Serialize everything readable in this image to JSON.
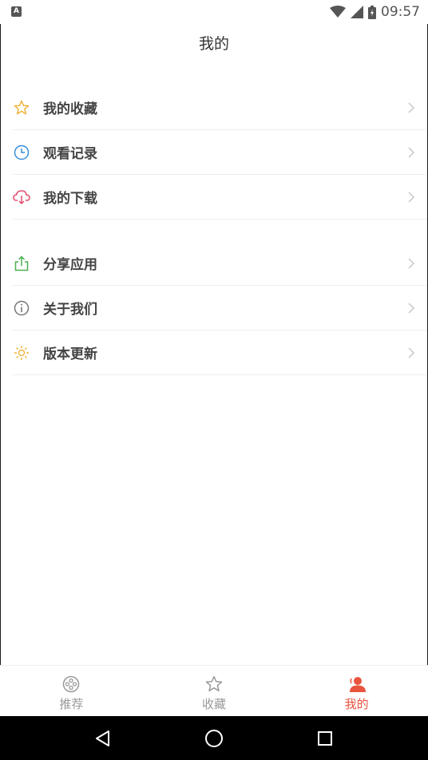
{
  "status_bar": {
    "time": "09:57",
    "left_badge": "A"
  },
  "header": {
    "title": "我的"
  },
  "menu": {
    "group1": [
      {
        "label": "我的收藏",
        "icon": "star-icon",
        "color": "#f0b43c"
      },
      {
        "label": "观看记录",
        "icon": "clock-icon",
        "color": "#3a8fd9"
      },
      {
        "label": "我的下载",
        "icon": "cloud-download-icon",
        "color": "#e24f6f"
      }
    ],
    "group2": [
      {
        "label": "分享应用",
        "icon": "share-icon",
        "color": "#4caf50"
      },
      {
        "label": "关于我们",
        "icon": "info-icon",
        "color": "#777777"
      },
      {
        "label": "版本更新",
        "icon": "sun-update-icon",
        "color": "#f0b43c"
      }
    ]
  },
  "bottom_nav": {
    "items": [
      {
        "label": "推荐",
        "icon": "film-reel-icon"
      },
      {
        "label": "收藏",
        "icon": "star-icon"
      },
      {
        "label": "我的",
        "icon": "user-icon"
      }
    ],
    "active_index": 2,
    "active_color": "#e9543e"
  }
}
